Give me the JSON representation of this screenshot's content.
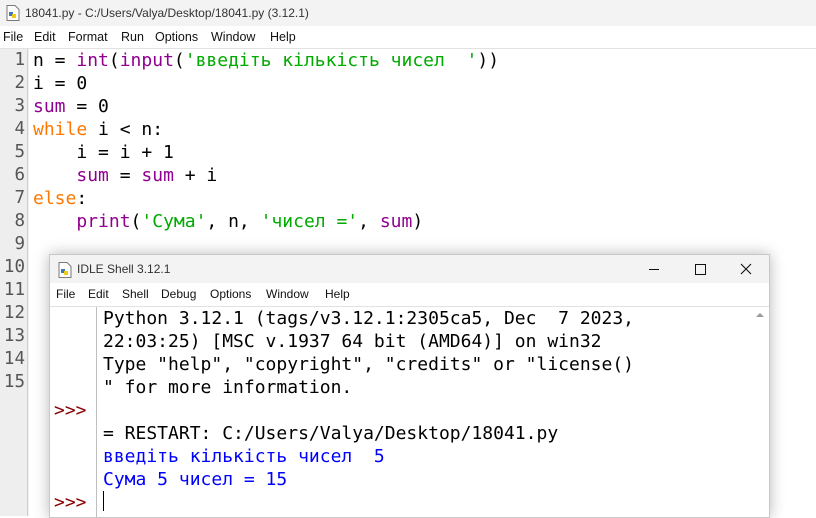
{
  "editor": {
    "title": "18041.py - C:/Users/Valya/Desktop/18041.py (3.12.1)",
    "menu": [
      "File",
      "Edit",
      "Format",
      "Run",
      "Options",
      "Window",
      "Help"
    ],
    "line_numbers": [
      "1",
      "2",
      "3",
      "4",
      "5",
      "6",
      "7",
      "8",
      "9",
      "10",
      "11",
      "12",
      "13",
      "14",
      "15"
    ],
    "code": [
      [
        {
          "t": "n = ",
          "c": ""
        },
        {
          "t": "int",
          "c": "bi"
        },
        {
          "t": "(",
          "c": ""
        },
        {
          "t": "input",
          "c": "bi"
        },
        {
          "t": "(",
          "c": ""
        },
        {
          "t": "'введіть кількість чисел  '",
          "c": "st"
        },
        {
          "t": "))",
          "c": ""
        }
      ],
      [
        {
          "t": "i = 0",
          "c": ""
        }
      ],
      [
        {
          "t": "sum",
          "c": "bi"
        },
        {
          "t": " = 0",
          "c": ""
        }
      ],
      [
        {
          "t": "while",
          "c": "kw"
        },
        {
          "t": " i < n:",
          "c": ""
        }
      ],
      [
        {
          "t": "    i = i + 1",
          "c": ""
        }
      ],
      [
        {
          "t": "    ",
          "c": ""
        },
        {
          "t": "sum",
          "c": "bi"
        },
        {
          "t": " = ",
          "c": ""
        },
        {
          "t": "sum",
          "c": "bi"
        },
        {
          "t": " + i",
          "c": ""
        }
      ],
      [
        {
          "t": "else",
          "c": "kw"
        },
        {
          "t": ":",
          "c": ""
        }
      ],
      [
        {
          "t": "    ",
          "c": ""
        },
        {
          "t": "print",
          "c": "bi"
        },
        {
          "t": "(",
          "c": ""
        },
        {
          "t": "'Сума'",
          "c": "st"
        },
        {
          "t": ", n, ",
          "c": ""
        },
        {
          "t": "'чисел ='",
          "c": "st"
        },
        {
          "t": ", ",
          "c": ""
        },
        {
          "t": "sum",
          "c": "bi"
        },
        {
          "t": ")",
          "c": ""
        }
      ]
    ]
  },
  "shell": {
    "title": "IDLE Shell 3.12.1",
    "menu": [
      "File",
      "Edit",
      "Shell",
      "Debug",
      "Options",
      "Window",
      "Help"
    ],
    "prompt": ">>>",
    "banner": [
      "Python 3.12.1 (tags/v3.12.1:2305ca5, Dec  7 2023,",
      "22:03:25) [MSC v.1937 64 bit (AMD64)] on win32",
      "Type \"help\", \"copyright\", \"credits\" or \"license()",
      "\" for more information."
    ],
    "restart": "= RESTART: C:/Users/Valya/Desktop/18041.py",
    "output": [
      "введіть кількість чисел  5",
      "Сума 5 чисел = 15"
    ]
  },
  "colors": {
    "keyword": "#ff7700",
    "builtin": "#900090",
    "string": "#00aa00",
    "stdout": "#0000ff",
    "prompt": "#880000"
  }
}
